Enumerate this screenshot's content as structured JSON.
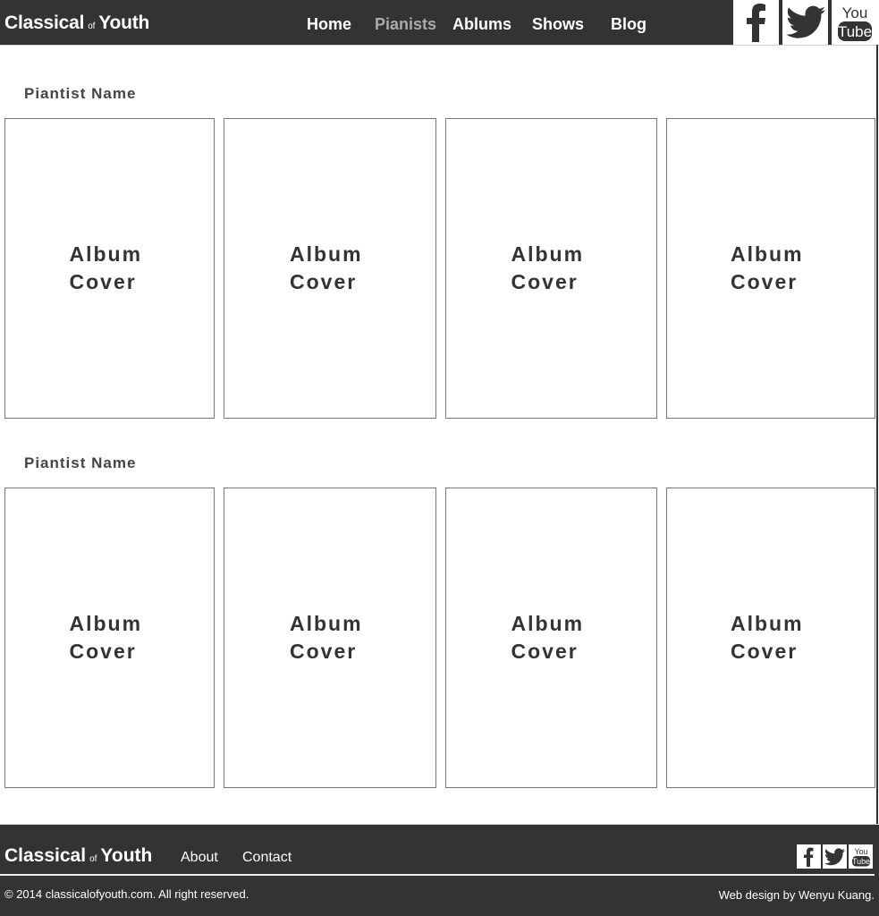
{
  "header": {
    "logo": {
      "primary": "Classical",
      "connector": "of",
      "secondary": "Youth"
    },
    "nav": [
      {
        "label": "Home",
        "active": false
      },
      {
        "label": "Pianists",
        "active": true
      },
      {
        "label": "Ablums",
        "active": false
      },
      {
        "label": "Shows",
        "active": false
      },
      {
        "label": "Blog",
        "active": false
      }
    ],
    "social": [
      {
        "name": "facebook",
        "icon": "facebook-icon"
      },
      {
        "name": "twitter",
        "icon": "twitter-icon"
      },
      {
        "name": "youtube",
        "icon": "youtube-icon",
        "text_top": "You",
        "text_bottom": "Tube"
      }
    ]
  },
  "sections": [
    {
      "title": "Piantist Name",
      "albums": [
        {
          "line1": "Album",
          "line2": "Cover"
        },
        {
          "line1": "Album",
          "line2": "Cover"
        },
        {
          "line1": "Album",
          "line2": "Cover"
        },
        {
          "line1": "Album",
          "line2": "Cover"
        }
      ]
    },
    {
      "title": "Piantist Name",
      "albums": [
        {
          "line1": "Album",
          "line2": "Cover"
        },
        {
          "line1": "Album",
          "line2": "Cover"
        },
        {
          "line1": "Album",
          "line2": "Cover"
        },
        {
          "line1": "Album",
          "line2": "Cover"
        }
      ]
    }
  ],
  "footer": {
    "logo": {
      "primary": "Classical",
      "connector": "of",
      "secondary": "Youth"
    },
    "links": [
      "About",
      "Contact"
    ],
    "copyright": "© 2014 classicalofyouth.com. All right reserved.",
    "credit": "Web design by Wenyu Kuang.",
    "social": [
      {
        "name": "facebook",
        "icon": "facebook-icon"
      },
      {
        "name": "twitter",
        "icon": "twitter-icon"
      },
      {
        "name": "youtube",
        "icon": "youtube-icon",
        "text_top": "You",
        "text_bottom": "Tube"
      }
    ]
  },
  "colors": {
    "bar": "#333333",
    "nav_active": "#aaaaaa",
    "text": "#ffffff",
    "card_border": "#777777"
  }
}
